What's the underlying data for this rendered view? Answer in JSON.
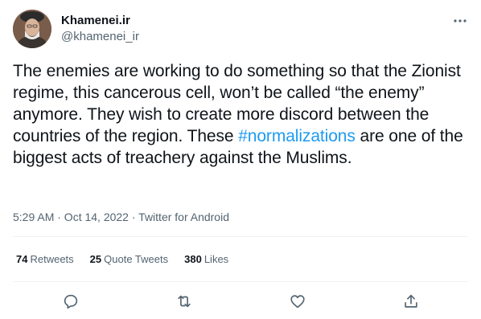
{
  "tweet": {
    "author": {
      "display_name": "Khamenei.ir",
      "handle": "@khamenei_ir"
    },
    "text": {
      "before_hashtag": "The enemies are working to do something so that the Zionist regime, this cancerous cell, won’t be called “the enemy” anymore. They wish to create more discord between the countries of the region. These ",
      "hashtag": "#normalizations",
      "after_hashtag": " are one of the biggest acts of treachery against the Muslims."
    },
    "meta": "5:29 AM · Oct 14, 2022 · Twitter for Android",
    "stats": {
      "retweets_count": "74",
      "retweets_label": "Retweets",
      "quotes_count": "25",
      "quotes_label": "Quote Tweets",
      "likes_count": "380",
      "likes_label": "Likes"
    },
    "icons": {
      "more": "more-icon",
      "reply": "reply-icon",
      "retweet": "retweet-icon",
      "like": "like-icon",
      "share": "share-icon"
    },
    "colors": {
      "text": "#0f1419",
      "secondary": "#536471",
      "link": "#1d9bf0",
      "divider": "#eff3f4"
    }
  }
}
